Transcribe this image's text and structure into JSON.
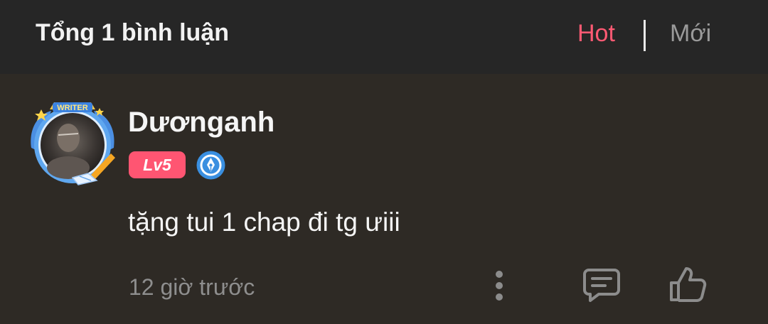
{
  "header": {
    "title": "Tổng 1 bình luận",
    "sort_tabs": [
      "Hot",
      "Mới"
    ],
    "active_tab": "Hot"
  },
  "comment": {
    "username": "Dươnganh",
    "level": "Lv5",
    "avatar_frame_label": "WRITER",
    "text": "tặng tui 1 chap đi tg ưiii",
    "time": "12 giờ trước",
    "actions": {
      "more_icon": "more-vertical-icon",
      "reply_icon": "comment-reply-icon",
      "like_icon": "thumbs-up-icon"
    }
  },
  "colors": {
    "header_bg": "#262626",
    "body_bg": "#2e2a25",
    "accent": "#ff5a73",
    "muted_text": "#8e8e8e",
    "badge_blue": "#3a8fe0"
  }
}
